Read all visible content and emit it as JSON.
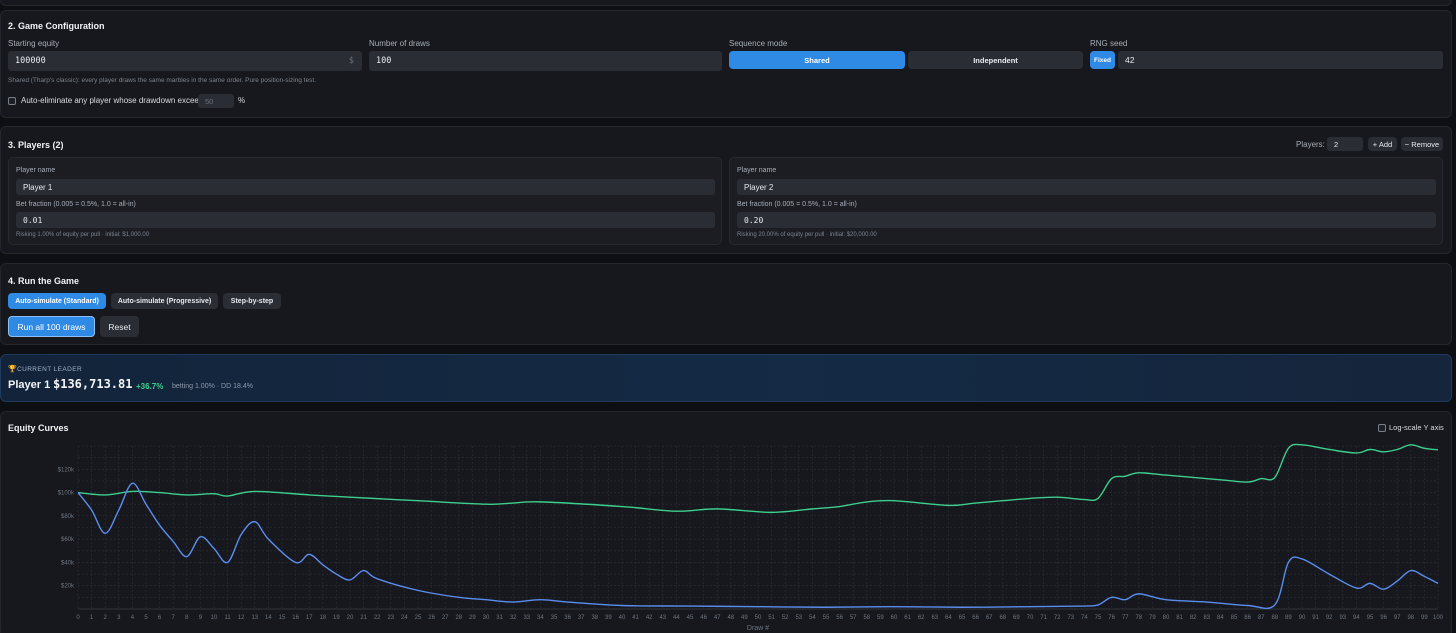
{
  "config": {
    "title": "2. Game Configuration",
    "starting_equity_label": "Starting equity",
    "starting_equity_value": "100000",
    "starting_equity_suffix": "$",
    "draws_label": "Number of draws",
    "draws_value": "100",
    "sequence_label": "Sequence mode",
    "seq_shared": "Shared",
    "seq_independent": "Independent",
    "rng_label": "RNG seed",
    "rng_fixed": "Fixed",
    "rng_value": "42",
    "note": "Shared (Tharp's classic): every player draws the same marbles in the same order. Pure position-sizing test.",
    "auto_elim_label": "Auto-eliminate any player whose drawdown exceeds",
    "auto_elim_placeholder": "50",
    "auto_elim_unit": "%"
  },
  "players": {
    "title": "3. Players (2)",
    "count_label": "Players:",
    "count_value": "2",
    "add_label": "+ Add",
    "remove_label": "− Remove",
    "list": [
      {
        "name_label": "Player name",
        "name": "Player 1",
        "bet_label": "Bet fraction (0.005 = 0.5%, 1.0 = all-in)",
        "bet": "0.01",
        "risk_note": "Risking 1.00% of equity per pull · initial: $1,000.00"
      },
      {
        "name_label": "Player name",
        "name": "Player 2",
        "bet_label": "Bet fraction (0.005 = 0.5%, 1.0 = all-in)",
        "bet": "0.20",
        "risk_note": "Risking 20.00% of equity per pull · initial: $20,000.00"
      }
    ]
  },
  "run": {
    "title": "4. Run the Game",
    "mode_standard": "Auto-simulate (Standard)",
    "mode_progressive": "Auto-simulate (Progressive)",
    "mode_step": "Step-by-step",
    "run_all": "Run all 100 draws",
    "reset": "Reset"
  },
  "leader": {
    "heading": "CURRENT LEADER",
    "name": "Player 1",
    "equity": "$136,713.81",
    "change": "+36.7%",
    "details": "betting 1.00% · DD 18.4%"
  },
  "curves": {
    "title": "Equity Curves",
    "log_label": "Log-scale Y axis"
  },
  "chart_data": {
    "type": "line",
    "xlabel": "Draw #",
    "ylabel": "",
    "xlim": [
      0,
      100
    ],
    "ylim": [
      0,
      140000
    ],
    "y_ticks": [
      20000,
      40000,
      60000,
      80000,
      100000,
      120000
    ],
    "y_tick_labels": [
      "$20k",
      "$40k",
      "$60k",
      "$80k",
      "$100k",
      "$120k"
    ],
    "grid": true,
    "series": [
      {
        "color": "#3ecf8e",
        "points": [
          [
            0,
            100000
          ],
          [
            2,
            98000
          ],
          [
            4,
            101000
          ],
          [
            6,
            100000
          ],
          [
            8,
            98000
          ],
          [
            10,
            99000
          ],
          [
            11,
            97000
          ],
          [
            13,
            101000
          ],
          [
            17,
            98000
          ],
          [
            20,
            96000
          ],
          [
            25,
            93000
          ],
          [
            30,
            90000
          ],
          [
            32,
            91000
          ],
          [
            34,
            92000
          ],
          [
            40,
            88000
          ],
          [
            44,
            84000
          ],
          [
            47,
            86000
          ],
          [
            51,
            83000
          ],
          [
            54,
            86000
          ],
          [
            56,
            88000
          ],
          [
            58,
            92000
          ],
          [
            60,
            93000
          ],
          [
            64,
            89000
          ],
          [
            66,
            91000
          ],
          [
            68,
            93000
          ],
          [
            70,
            95000
          ],
          [
            72,
            96000
          ],
          [
            74,
            94000
          ],
          [
            75,
            95000
          ],
          [
            76,
            112000
          ],
          [
            77,
            114000
          ],
          [
            78,
            117000
          ],
          [
            80,
            115000
          ],
          [
            84,
            111000
          ],
          [
            86,
            109000
          ],
          [
            87,
            112000
          ],
          [
            88,
            113000
          ],
          [
            89,
            138000
          ],
          [
            90,
            141000
          ],
          [
            92,
            137000
          ],
          [
            94,
            134000
          ],
          [
            95,
            137000
          ],
          [
            96,
            135000
          ],
          [
            97,
            137000
          ],
          [
            98,
            141000
          ],
          [
            99,
            138000
          ],
          [
            100,
            136700
          ]
        ]
      },
      {
        "color": "#5b8def",
        "points": [
          [
            0,
            100000
          ],
          [
            1,
            85000
          ],
          [
            2,
            65000
          ],
          [
            3,
            85000
          ],
          [
            4,
            108000
          ],
          [
            5,
            90000
          ],
          [
            6,
            72000
          ],
          [
            7,
            58000
          ],
          [
            8,
            45000
          ],
          [
            9,
            62000
          ],
          [
            10,
            52000
          ],
          [
            11,
            40000
          ],
          [
            12,
            64000
          ],
          [
            13,
            75000
          ],
          [
            14,
            60000
          ],
          [
            16,
            40000
          ],
          [
            17,
            47000
          ],
          [
            18,
            38000
          ],
          [
            19,
            30000
          ],
          [
            20,
            25000
          ],
          [
            21,
            33000
          ],
          [
            22,
            26000
          ],
          [
            25,
            16000
          ],
          [
            28,
            10000
          ],
          [
            30,
            8000
          ],
          [
            32,
            6000
          ],
          [
            34,
            8000
          ],
          [
            36,
            6000
          ],
          [
            40,
            3000
          ],
          [
            45,
            2500
          ],
          [
            50,
            2000
          ],
          [
            55,
            1500
          ],
          [
            60,
            2000
          ],
          [
            65,
            1500
          ],
          [
            70,
            2000
          ],
          [
            74,
            2500
          ],
          [
            75,
            3500
          ],
          [
            76,
            10000
          ],
          [
            77,
            8000
          ],
          [
            78,
            13000
          ],
          [
            80,
            8000
          ],
          [
            83,
            6000
          ],
          [
            86,
            3000
          ],
          [
            88,
            3500
          ],
          [
            89,
            40000
          ],
          [
            90,
            43000
          ],
          [
            92,
            30000
          ],
          [
            94,
            18000
          ],
          [
            95,
            22000
          ],
          [
            96,
            17000
          ],
          [
            97,
            24000
          ],
          [
            98,
            33000
          ],
          [
            99,
            28000
          ],
          [
            100,
            22000
          ]
        ]
      }
    ]
  }
}
